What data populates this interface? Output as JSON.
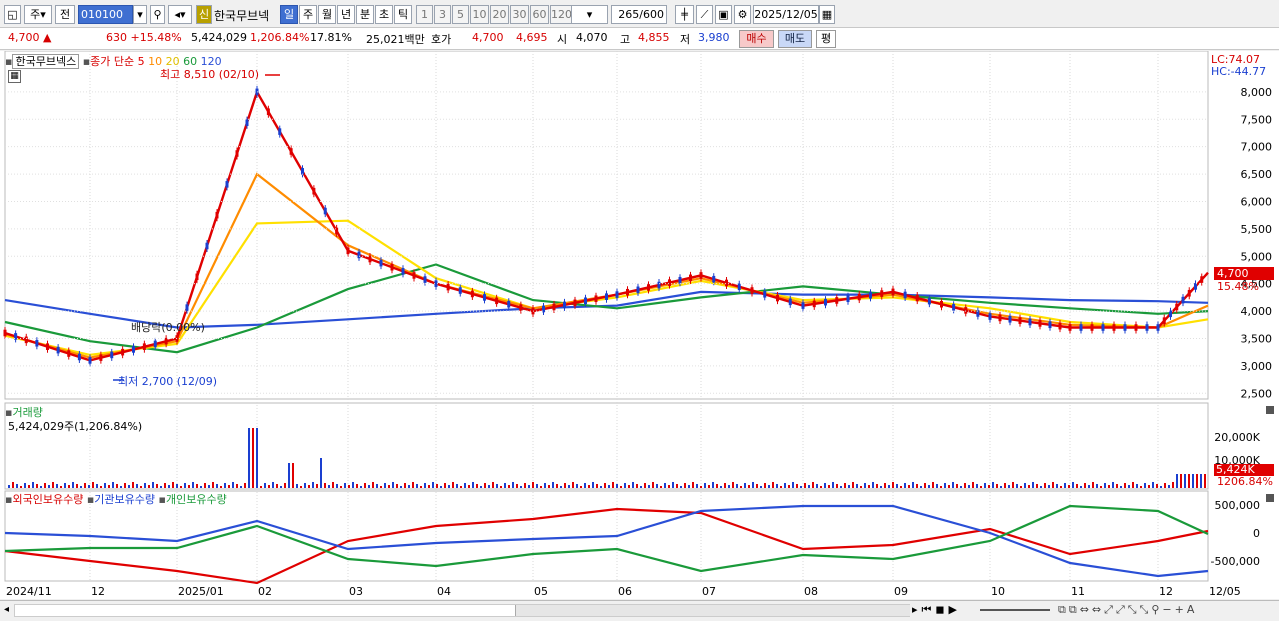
{
  "toolbar": {
    "code": "010100",
    "name": "한국무브넥",
    "badge": "신",
    "mode1": "주",
    "mode2": "전",
    "periods": [
      "일",
      "주",
      "월",
      "년",
      "분",
      "초",
      "틱"
    ],
    "minutes": [
      "1",
      "3",
      "5",
      "10",
      "20",
      "30",
      "60",
      "120"
    ],
    "count": "265",
    "count_max": "/600",
    "date": "2025/12/05"
  },
  "info": {
    "price": "4,700 ▲",
    "change": "630 +15.48%",
    "volume": "5,424,029",
    "volume_ratio": "1,206.84%",
    "turnover": "17.81%",
    "amount": "25,021백만",
    "hoga_label": "호가",
    "ask": "4,700",
    "bid": "4,695",
    "open_label": "시",
    "open": "4,070",
    "high_label": "고",
    "high": "4,855",
    "low_label": "저",
    "low": "3,980",
    "buy": "매수",
    "sell": "매도",
    "eval": "평"
  },
  "main_panel": {
    "name": "한국무브넥스",
    "indicator": "종가 단순",
    "ma": [
      "5",
      "10",
      "20",
      "60",
      "120"
    ],
    "high_note": "최고 8,510 (02/10)",
    "low_note": "최저 2,700 (12/09)",
    "dividend_note": "배당락(0.00%)",
    "lc": "LC:74.07",
    "hc": "HC:-44.77",
    "last_price": "4,700",
    "last_pct": "15.48%",
    "y_ticks": [
      "8,000",
      "7,500",
      "7,000",
      "6,500",
      "6,000",
      "5,500",
      "5,000",
      "4,500",
      "4,000",
      "3,500",
      "3,000",
      "2,500"
    ]
  },
  "volume_panel": {
    "title": "거래량",
    "value": "5,424,029주(1,206.84%)",
    "ticks": [
      "20,000K",
      "10,000K"
    ],
    "last": "5,424K",
    "last_pct": "1206.84%"
  },
  "holding_panel": {
    "legend": [
      "외국인보유수량",
      "기관보유수량",
      "개인보유수량"
    ],
    "ticks": [
      "500,000",
      "0",
      "-500,000"
    ]
  },
  "x_axis": [
    "2024/11",
    "12",
    "2025/01",
    "02",
    "03",
    "04",
    "05",
    "06",
    "07",
    "08",
    "09",
    "10",
    "11",
    "12",
    "12/05"
  ],
  "colors": {
    "ma5": "#e00000",
    "ma10": "#ff8c00",
    "ma20": "#ffe000",
    "ma60": "#1a9a3a",
    "ma120": "#2a4fd6",
    "up": "#e00000",
    "down": "#1a3fd0"
  },
  "chart_data": {
    "type": "line",
    "title": "한국무브넥스",
    "x": [
      "2024/11",
      "12",
      "2025/01",
      "02",
      "03",
      "04",
      "05",
      "06",
      "07",
      "08",
      "09",
      "10",
      "11",
      "12",
      "12/05"
    ],
    "ylim": [
      2450,
      8600
    ],
    "series": [
      {
        "name": "5",
        "values": [
          3600,
          3100,
          3500,
          8000,
          5100,
          4500,
          4000,
          4300,
          4650,
          4100,
          4350,
          3900,
          3700,
          3700,
          4700
        ]
      },
      {
        "name": "10",
        "values": [
          3580,
          3150,
          3450,
          6500,
          5200,
          4500,
          4050,
          4300,
          4600,
          4150,
          4300,
          3950,
          3750,
          3700,
          4100
        ]
      },
      {
        "name": "20",
        "values": [
          3550,
          3200,
          3400,
          5600,
          5650,
          4600,
          4050,
          4250,
          4550,
          4200,
          4250,
          4050,
          3800,
          3700,
          3850
        ]
      },
      {
        "name": "60",
        "values": [
          3800,
          3450,
          3250,
          3700,
          4400,
          4850,
          4200,
          4050,
          4250,
          4450,
          4300,
          4150,
          4050,
          3950,
          4000
        ]
      },
      {
        "name": "120",
        "values": [
          4200,
          3950,
          3700,
          3750,
          3850,
          3950,
          4050,
          4100,
          4350,
          4300,
          4300,
          4250,
          4200,
          4180,
          4150
        ]
      }
    ]
  }
}
